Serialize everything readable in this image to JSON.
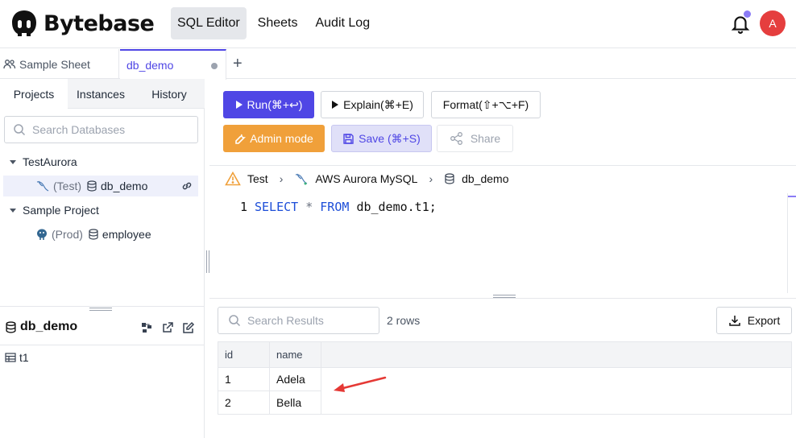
{
  "app": {
    "logo_text": "Bytebase",
    "nav": [
      "SQL Editor",
      "Sheets",
      "Audit Log"
    ],
    "avatar_initial": "A"
  },
  "tabs": {
    "sample": "Sample Sheet",
    "active": "db_demo",
    "add": "+"
  },
  "sidebar": {
    "tabs": [
      "Projects",
      "Instances",
      "History"
    ],
    "search_placeholder": "Search Databases",
    "tree": [
      {
        "project": "TestAurora",
        "env": "(Test)",
        "db": "db_demo"
      },
      {
        "project": "Sample Project",
        "env": "(Prod)",
        "db": "employee"
      }
    ],
    "db_panel": {
      "title": "db_demo",
      "tables": [
        "t1"
      ]
    }
  },
  "toolbar": {
    "run": "Run(⌘+↩)",
    "explain": "Explain(⌘+E)",
    "format": "Format(⇧+⌥+F)",
    "admin": "Admin mode",
    "save": "Save (⌘+S)",
    "share": "Share"
  },
  "breadcrumb": {
    "env": "Test",
    "instance": "AWS Aurora MySQL",
    "database": "db_demo"
  },
  "editor": {
    "line_number": "1",
    "kw_select": "SELECT",
    "star": "*",
    "kw_from": "FROM",
    "rest": "db_demo.t1;"
  },
  "results": {
    "search_placeholder": "Search Results",
    "row_count": "2 rows",
    "export": "Export",
    "columns": [
      "id",
      "name"
    ],
    "rows": [
      [
        "1",
        "Adela"
      ],
      [
        "2",
        "Bella"
      ]
    ]
  },
  "colors": {
    "primary": "#4f46e5",
    "admin": "#f0a03a",
    "avatar": "#e53e3e",
    "arrow": "#e53935"
  }
}
